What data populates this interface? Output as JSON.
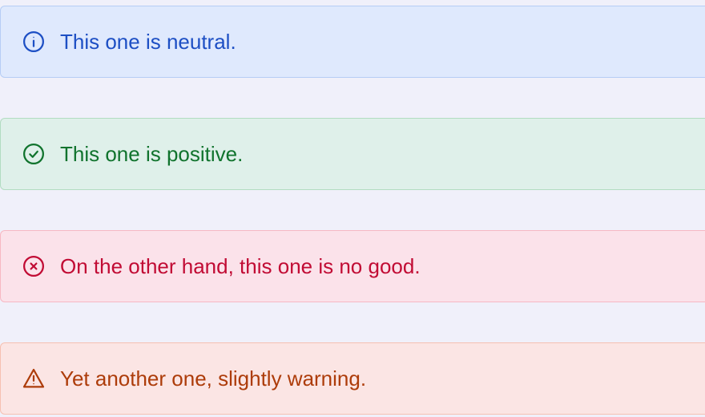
{
  "alerts": [
    {
      "variant": "neutral",
      "icon": "info-icon",
      "text": "This one is neutral.",
      "color": "#1d4fc4"
    },
    {
      "variant": "positive",
      "icon": "check-circle-icon",
      "text": "This one is positive.",
      "color": "#10732d"
    },
    {
      "variant": "negative",
      "icon": "x-circle-icon",
      "text": "On the other hand, this one is no good.",
      "color": "#c10b34"
    },
    {
      "variant": "warning",
      "icon": "warning-icon",
      "text": "Yet another one, slightly warning.",
      "color": "#ad3c0a"
    }
  ]
}
